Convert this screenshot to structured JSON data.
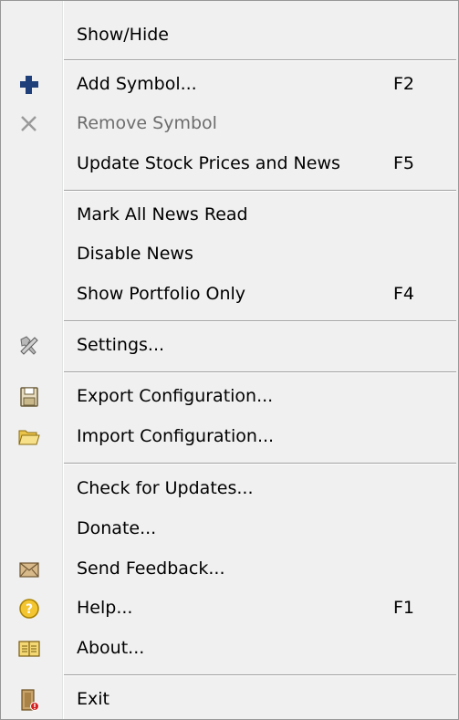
{
  "menu": {
    "items": [
      {
        "label": "Show/Hide",
        "accel": "",
        "icon": "",
        "disabled": false
      },
      {
        "label": "Add Symbol...",
        "accel": "F2",
        "icon": "plus-icon",
        "disabled": false
      },
      {
        "label": "Remove Symbol",
        "accel": "",
        "icon": "x-icon",
        "disabled": true
      },
      {
        "label": "Update Stock Prices and News",
        "accel": "F5",
        "icon": "",
        "disabled": false
      },
      {
        "label": "Mark All News Read",
        "accel": "",
        "icon": "",
        "disabled": false
      },
      {
        "label": "Disable News",
        "accel": "",
        "icon": "",
        "disabled": false
      },
      {
        "label": "Show Portfolio Only",
        "accel": "F4",
        "icon": "",
        "disabled": false
      },
      {
        "label": "Settings...",
        "accel": "",
        "icon": "tools-icon",
        "disabled": false
      },
      {
        "label": "Export Configuration...",
        "accel": "",
        "icon": "save-icon",
        "disabled": false
      },
      {
        "label": "Import Configuration...",
        "accel": "",
        "icon": "open-folder-icon",
        "disabled": false
      },
      {
        "label": "Check for Updates...",
        "accel": "",
        "icon": "",
        "disabled": false
      },
      {
        "label": "Donate...",
        "accel": "",
        "icon": "",
        "disabled": false
      },
      {
        "label": "Send Feedback...",
        "accel": "",
        "icon": "envelope-icon",
        "disabled": false
      },
      {
        "label": "Help...",
        "accel": "F1",
        "icon": "help-icon",
        "disabled": false
      },
      {
        "label": "About...",
        "accel": "",
        "icon": "book-icon",
        "disabled": false
      },
      {
        "label": "Exit",
        "accel": "",
        "icon": "exit-door-icon",
        "disabled": false
      }
    ]
  },
  "colors": {
    "menu_bg": "#f0f0f0",
    "plus_icon": "#1f3f7a",
    "x_icon": "#9a9a9a",
    "help_icon": "#e8b900",
    "folder_icon": "#f2d35a"
  }
}
